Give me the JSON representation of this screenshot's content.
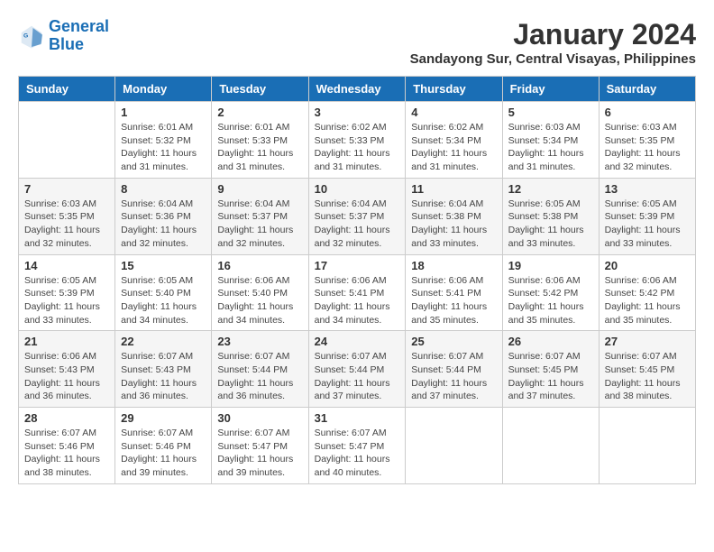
{
  "header": {
    "logo_line1": "General",
    "logo_line2": "Blue",
    "month": "January 2024",
    "location": "Sandayong Sur, Central Visayas, Philippines"
  },
  "weekdays": [
    "Sunday",
    "Monday",
    "Tuesday",
    "Wednesday",
    "Thursday",
    "Friday",
    "Saturday"
  ],
  "weeks": [
    [
      {
        "day": "",
        "text": ""
      },
      {
        "day": "1",
        "text": "Sunrise: 6:01 AM\nSunset: 5:32 PM\nDaylight: 11 hours\nand 31 minutes."
      },
      {
        "day": "2",
        "text": "Sunrise: 6:01 AM\nSunset: 5:33 PM\nDaylight: 11 hours\nand 31 minutes."
      },
      {
        "day": "3",
        "text": "Sunrise: 6:02 AM\nSunset: 5:33 PM\nDaylight: 11 hours\nand 31 minutes."
      },
      {
        "day": "4",
        "text": "Sunrise: 6:02 AM\nSunset: 5:34 PM\nDaylight: 11 hours\nand 31 minutes."
      },
      {
        "day": "5",
        "text": "Sunrise: 6:03 AM\nSunset: 5:34 PM\nDaylight: 11 hours\nand 31 minutes."
      },
      {
        "day": "6",
        "text": "Sunrise: 6:03 AM\nSunset: 5:35 PM\nDaylight: 11 hours\nand 32 minutes."
      }
    ],
    [
      {
        "day": "7",
        "text": "Sunrise: 6:03 AM\nSunset: 5:35 PM\nDaylight: 11 hours\nand 32 minutes."
      },
      {
        "day": "8",
        "text": "Sunrise: 6:04 AM\nSunset: 5:36 PM\nDaylight: 11 hours\nand 32 minutes."
      },
      {
        "day": "9",
        "text": "Sunrise: 6:04 AM\nSunset: 5:37 PM\nDaylight: 11 hours\nand 32 minutes."
      },
      {
        "day": "10",
        "text": "Sunrise: 6:04 AM\nSunset: 5:37 PM\nDaylight: 11 hours\nand 32 minutes."
      },
      {
        "day": "11",
        "text": "Sunrise: 6:04 AM\nSunset: 5:38 PM\nDaylight: 11 hours\nand 33 minutes."
      },
      {
        "day": "12",
        "text": "Sunrise: 6:05 AM\nSunset: 5:38 PM\nDaylight: 11 hours\nand 33 minutes."
      },
      {
        "day": "13",
        "text": "Sunrise: 6:05 AM\nSunset: 5:39 PM\nDaylight: 11 hours\nand 33 minutes."
      }
    ],
    [
      {
        "day": "14",
        "text": "Sunrise: 6:05 AM\nSunset: 5:39 PM\nDaylight: 11 hours\nand 33 minutes."
      },
      {
        "day": "15",
        "text": "Sunrise: 6:05 AM\nSunset: 5:40 PM\nDaylight: 11 hours\nand 34 minutes."
      },
      {
        "day": "16",
        "text": "Sunrise: 6:06 AM\nSunset: 5:40 PM\nDaylight: 11 hours\nand 34 minutes."
      },
      {
        "day": "17",
        "text": "Sunrise: 6:06 AM\nSunset: 5:41 PM\nDaylight: 11 hours\nand 34 minutes."
      },
      {
        "day": "18",
        "text": "Sunrise: 6:06 AM\nSunset: 5:41 PM\nDaylight: 11 hours\nand 35 minutes."
      },
      {
        "day": "19",
        "text": "Sunrise: 6:06 AM\nSunset: 5:42 PM\nDaylight: 11 hours\nand 35 minutes."
      },
      {
        "day": "20",
        "text": "Sunrise: 6:06 AM\nSunset: 5:42 PM\nDaylight: 11 hours\nand 35 minutes."
      }
    ],
    [
      {
        "day": "21",
        "text": "Sunrise: 6:06 AM\nSunset: 5:43 PM\nDaylight: 11 hours\nand 36 minutes."
      },
      {
        "day": "22",
        "text": "Sunrise: 6:07 AM\nSunset: 5:43 PM\nDaylight: 11 hours\nand 36 minutes."
      },
      {
        "day": "23",
        "text": "Sunrise: 6:07 AM\nSunset: 5:44 PM\nDaylight: 11 hours\nand 36 minutes."
      },
      {
        "day": "24",
        "text": "Sunrise: 6:07 AM\nSunset: 5:44 PM\nDaylight: 11 hours\nand 37 minutes."
      },
      {
        "day": "25",
        "text": "Sunrise: 6:07 AM\nSunset: 5:44 PM\nDaylight: 11 hours\nand 37 minutes."
      },
      {
        "day": "26",
        "text": "Sunrise: 6:07 AM\nSunset: 5:45 PM\nDaylight: 11 hours\nand 37 minutes."
      },
      {
        "day": "27",
        "text": "Sunrise: 6:07 AM\nSunset: 5:45 PM\nDaylight: 11 hours\nand 38 minutes."
      }
    ],
    [
      {
        "day": "28",
        "text": "Sunrise: 6:07 AM\nSunset: 5:46 PM\nDaylight: 11 hours\nand 38 minutes."
      },
      {
        "day": "29",
        "text": "Sunrise: 6:07 AM\nSunset: 5:46 PM\nDaylight: 11 hours\nand 39 minutes."
      },
      {
        "day": "30",
        "text": "Sunrise: 6:07 AM\nSunset: 5:47 PM\nDaylight: 11 hours\nand 39 minutes."
      },
      {
        "day": "31",
        "text": "Sunrise: 6:07 AM\nSunset: 5:47 PM\nDaylight: 11 hours\nand 40 minutes."
      },
      {
        "day": "",
        "text": ""
      },
      {
        "day": "",
        "text": ""
      },
      {
        "day": "",
        "text": ""
      }
    ]
  ]
}
